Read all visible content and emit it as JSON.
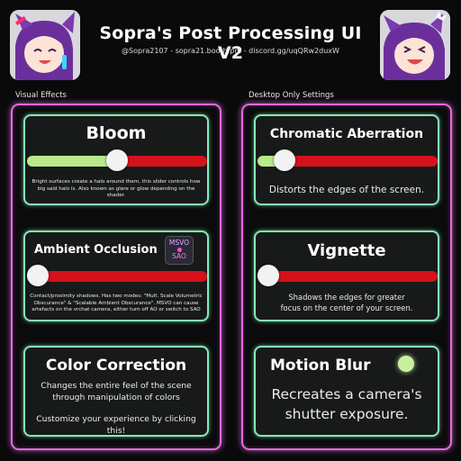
{
  "header": {
    "title": "Sopra's Post Processing UI V2",
    "subtitle": "@Sopra2107 - sopra21.booth.pm - discord.gg/uqQRw2duxW"
  },
  "sections": {
    "left_label": "Visual Effects",
    "right_label": "Desktop Only Settings"
  },
  "cards": {
    "bloom": {
      "title": "Bloom",
      "slider_value": 0.5,
      "description": "Bright surfaces create a halo around them, this slider controls how big said halo is. Also known as glare or glow depending on the shader."
    },
    "ambient_occlusion": {
      "title": "Ambient Occlusion",
      "slider_value": 0.0,
      "mode_top": "MSVO",
      "mode_bottom": "SAO",
      "description": "Contact/proximity shadows. Has two modes: \"Mult. Scale Volumetric Obscurance\" & \"Scalable Ambient Obscurance\". MSVO can cause artefacts on the vrchat camera, either turn off AO or switch to SAO"
    },
    "color_correction": {
      "title": "Color Correction",
      "description_1": "Changes the entire feel of the scene",
      "description_2": "through manipulation of colors",
      "description_3": "Customize your experience by clicking this!"
    },
    "chromatic_aberration": {
      "title": "Chromatic Aberration",
      "slider_value": 0.15,
      "description": "Distorts the edges of the screen."
    },
    "vignette": {
      "title": "Vignette",
      "slider_value": 0.05,
      "description_1": "Shadows the edges for greater",
      "description_2": "focus on the center of your screen."
    },
    "motion_blur": {
      "title": "Motion Blur",
      "toggle_on": true,
      "description_1": "Recreates a camera's",
      "description_2": "shutter exposure."
    }
  },
  "colors": {
    "panel_border": "#e46ae0",
    "card_border": "#86e8b5",
    "slider_fill": "#b8e98a",
    "slider_track": "#d5121c",
    "toggle_on": "#c8f09c"
  },
  "icons": {
    "avatar_left": "anime-avatar-purple-hair",
    "avatar_right": "anime-avatar-purple-hair"
  }
}
